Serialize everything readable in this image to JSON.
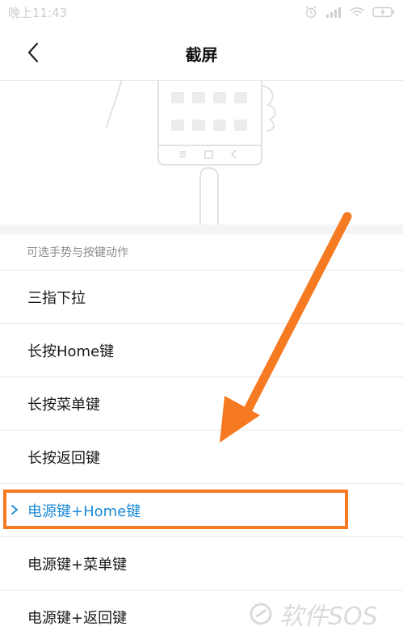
{
  "status_bar": {
    "time": "晚上11:43"
  },
  "header": {
    "title": "截屏"
  },
  "section": {
    "title": "可选手势与按键动作"
  },
  "options": [
    {
      "label": "三指下拉",
      "selected": false
    },
    {
      "label": "长按Home键",
      "selected": false
    },
    {
      "label": "长按菜单键",
      "selected": false
    },
    {
      "label": "长按返回键",
      "selected": false
    },
    {
      "label": "电源键+Home键",
      "selected": true
    },
    {
      "label": "电源键+菜单键",
      "selected": false
    },
    {
      "label": "电源键+返回键",
      "selected": false
    }
  ],
  "watermark": {
    "text": "软件SOS"
  },
  "colors": {
    "accent": "#1b8bd6",
    "highlight": "#f57a22",
    "arrow": "#f57a22"
  },
  "icons": [
    "back-arrow-icon",
    "alarm-icon",
    "signal-icon",
    "wifi-icon",
    "battery-icon",
    "chevron-right-icon"
  ]
}
